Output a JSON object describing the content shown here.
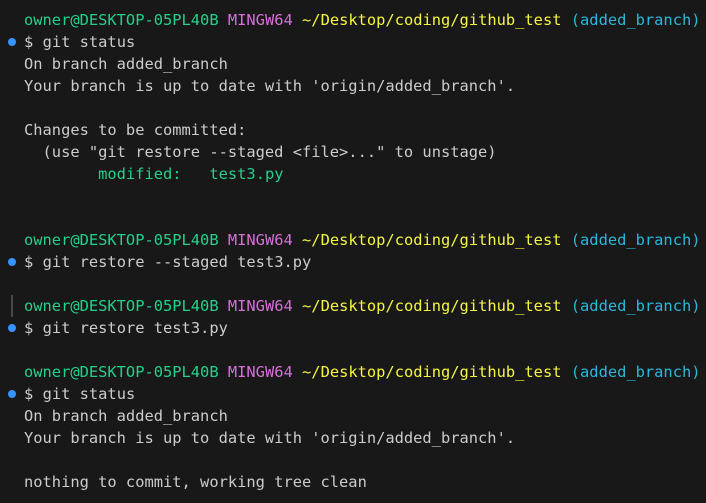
{
  "colors": {
    "background": "#181818",
    "text": "#cccccc",
    "user_host": "#23d18b",
    "mingw": "#d670d6",
    "path": "#f5f543",
    "branch": "#29b8db",
    "modified": "#23d18b",
    "command_dot": "#3794ff"
  },
  "icons": {
    "command_marker": "command-decoration-dot-icon"
  },
  "prompt": {
    "user_host": "owner@DESKTOP-05PL40B",
    "shell": "MINGW64",
    "path": "~/Desktop/coding/github_test",
    "branch": "(added_branch)",
    "symbol": "$"
  },
  "blocks": [
    {
      "command": "git status",
      "output": [
        "On branch added_branch",
        "Your branch is up to date with 'origin/added_branch'.",
        "",
        "Changes to be committed:",
        "  (use \"git restore --staged <file>...\" to unstage)"
      ],
      "modified_label": "modified:",
      "modified_file": "test3.py"
    },
    {
      "command": "git restore --staged test3.py",
      "output": []
    },
    {
      "command": "git restore test3.py",
      "output": []
    },
    {
      "command": "git status",
      "output": [
        "On branch added_branch",
        "Your branch is up to date with 'origin/added_branch'.",
        "",
        "nothing to commit, working tree clean"
      ]
    }
  ]
}
